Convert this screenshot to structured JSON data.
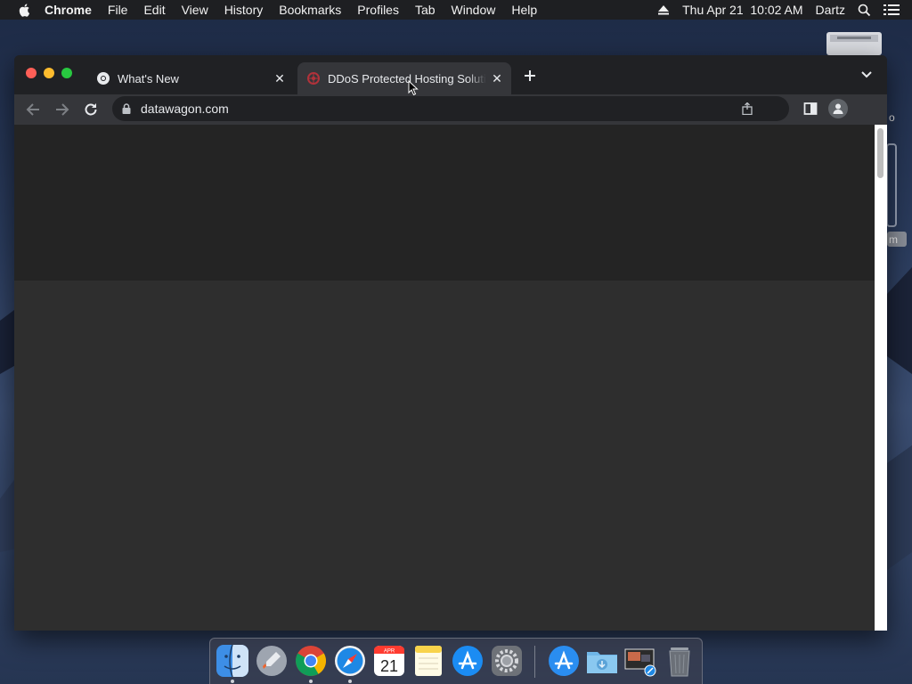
{
  "menubar": {
    "app_name": "Chrome",
    "items": [
      "File",
      "Edit",
      "View",
      "History",
      "Bookmarks",
      "Profiles",
      "Tab",
      "Window",
      "Help"
    ],
    "datetime": "Thu Apr 21  10:02 AM",
    "user": "Dartz"
  },
  "browser": {
    "tabs": [
      {
        "title": "What's New",
        "icon": "chrome-icon",
        "active": false
      },
      {
        "title": "DDoS Protected Hosting Solutions",
        "icon": "datawagon-favicon",
        "active": true
      }
    ],
    "url": "datawagon.com"
  },
  "dock": {
    "items": [
      "finder-icon",
      "launchpad-icon",
      "chrome-icon",
      "safari-icon",
      "calendar-icon",
      "notes-icon",
      "app-store-icon",
      "system-preferences-icon",
      "applications-folder-icon",
      "downloads-folder-icon",
      "preview-stack-icon",
      "trash-icon"
    ],
    "calendar": {
      "month": "APR",
      "day": "21"
    }
  },
  "colors": {
    "window_bg": "#202124",
    "toolbar_bg": "#35363a",
    "content_bg": "#2e2e2e",
    "accent_red": "#ff5f57",
    "accent_yellow": "#febc2e",
    "accent_green": "#28c840"
  }
}
